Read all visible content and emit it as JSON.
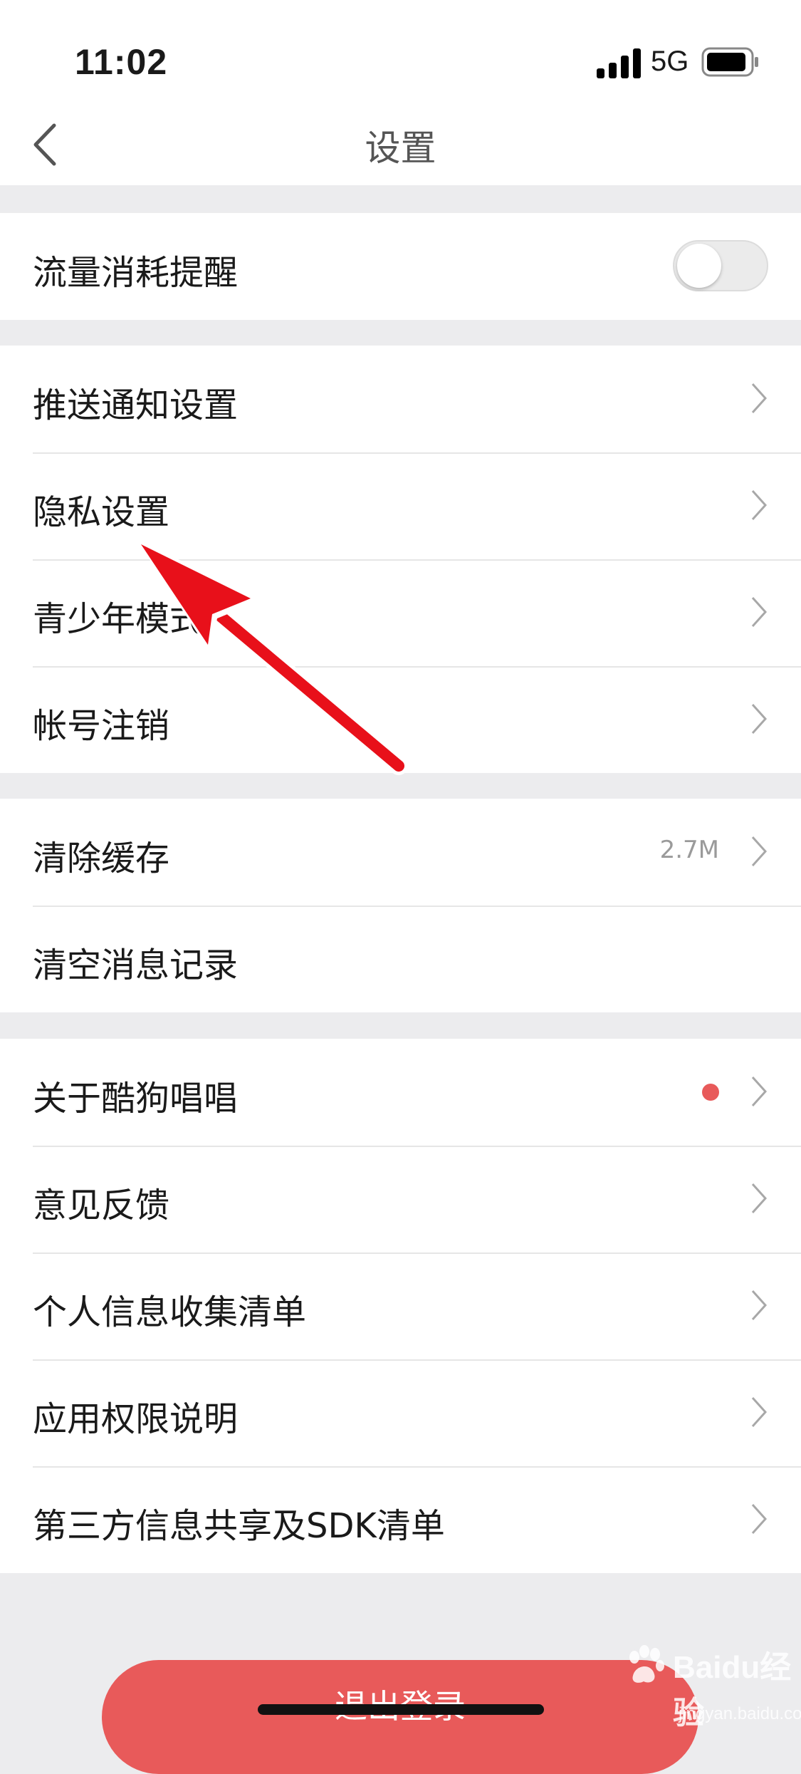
{
  "status_bar": {
    "time": "11:02",
    "network": "5G"
  },
  "nav": {
    "title": "设置"
  },
  "groups": [
    {
      "rows": [
        {
          "label": "流量消耗提醒",
          "toggle_on": false
        }
      ]
    },
    {
      "rows": [
        {
          "label": "推送通知设置"
        },
        {
          "label": "隐私设置"
        },
        {
          "label": "青少年模式"
        },
        {
          "label": "帐号注销"
        }
      ]
    },
    {
      "rows": [
        {
          "label": "清除缓存",
          "value": "2.7M"
        },
        {
          "label": "清空消息记录"
        }
      ]
    },
    {
      "rows": [
        {
          "label": "关于酷狗唱唱",
          "badge": "red-dot"
        },
        {
          "label": "意见反馈"
        },
        {
          "label": "个人信息收集清单"
        },
        {
          "label": "应用权限说明"
        },
        {
          "label": "第三方信息共享及SDK清单"
        }
      ]
    }
  ],
  "logout_label": "退出登录",
  "watermark": {
    "text": "Baidu经验",
    "sub": "jingyan.baidu.com"
  },
  "colors": {
    "accent_red": "#e85a5a",
    "annotation_arrow": "#e8101a",
    "background": "#ececee"
  }
}
